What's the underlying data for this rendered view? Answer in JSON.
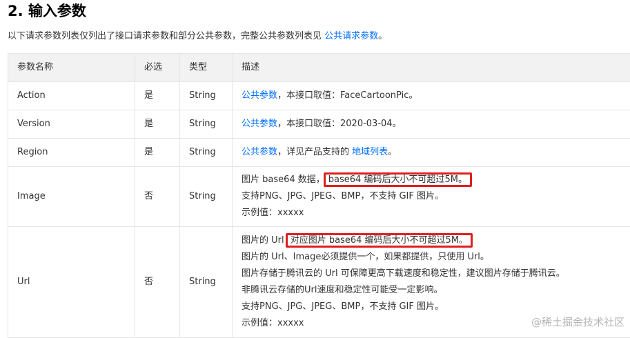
{
  "section": {
    "heading": "2. 输入参数",
    "intro_text": "以下请求参数列表仅列出了接口请求参数和部分公共参数，完整公共参数列表见 ",
    "intro_link": "公共请求参数",
    "intro_end": "。"
  },
  "table": {
    "headers": [
      "参数名称",
      "必选",
      "类型",
      "描述"
    ],
    "rows": [
      {
        "name": "Action",
        "required": "是",
        "type": "String",
        "desc_link": "公共参数",
        "desc_text": "，本接口取值：FaceCartoonPic。"
      },
      {
        "name": "Version",
        "required": "是",
        "type": "String",
        "desc_link": "公共参数",
        "desc_text": "，本接口取值：2020-03-04。"
      },
      {
        "name": "Region",
        "required": "是",
        "type": "String",
        "desc_link": "公共参数",
        "desc_text": "，详见产品支持的 ",
        "desc_link2": "地域列表",
        "desc_end": "。"
      },
      {
        "name": "Image",
        "required": "否",
        "type": "String",
        "desc_line1_pre": "图片 base64 数据，",
        "desc_line1_highlight": "base64 编码后大小不可超过5M。",
        "desc_line2": "支持PNG、JPG、JPEG、BMP，不支持 GIF 图片。",
        "desc_line3": "示例值：xxxxx"
      },
      {
        "name": "Url",
        "required": "否",
        "type": "String",
        "desc_line1_pre": "图片的 Url ",
        "desc_line1_highlight": "对应图片 base64 编码后大小不可超过5M。",
        "desc_line2": "图片的 Url、Image必须提供一个，如果都提供，只使用 Url。",
        "desc_line3": "图片存储于腾讯云的 Url 可保障更高下载速度和稳定性，建议图片存储于腾讯云。",
        "desc_line4": "非腾讯云存储的Url速度和稳定性可能受一定影响。",
        "desc_line5": "支持PNG、JPG、JPEG、BMP，不支持 GIF 图片。",
        "desc_line6": "示例值：xxxxx"
      }
    ]
  },
  "watermark": "@稀土掘金技术社区",
  "colors": {
    "link": "#006eff",
    "highlight_border": "#e01d1d",
    "header_bg": "#f2f2f2",
    "border": "#e5e5e5"
  }
}
